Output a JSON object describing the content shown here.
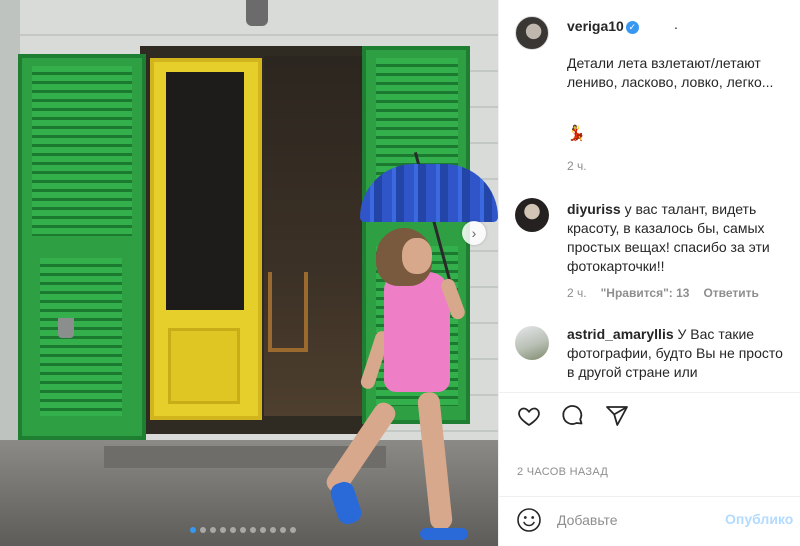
{
  "post": {
    "author": "veriga10",
    "author_suffix": ".",
    "caption": "Детали лета взлетают/летают лениво, ласково, ловко, легко...",
    "emoji": "💃",
    "time": "2 ч.",
    "posted_ago": "2 ЧАСОВ НАЗАД",
    "carousel_dots": 11,
    "active_dot": 0
  },
  "comments": [
    {
      "user": "diyuriss",
      "text": "у вас талант, видеть красоту, в казалось бы, самых простых вещах! спасибо за эти фотокарточки!!",
      "time": "2 ч.",
      "likes": "\"Нравится\": 13",
      "reply": "Ответить"
    },
    {
      "user": "astrid_amaryllis",
      "text": "У Вас такие фотографии, будто Вы не просто в другой стране или"
    }
  ],
  "comment_box": {
    "placeholder": "Добавьте",
    "publish": "Опублико"
  },
  "icons": {
    "like": "heart-icon",
    "comment": "comment-icon",
    "share": "paper-plane-icon",
    "emoji": "smile-icon",
    "verified": "verified-badge-icon",
    "next": "chevron-right-icon"
  },
  "colors": {
    "accent": "#3897f0",
    "publish_disabled": "#b3dbff",
    "secondary_text": "#8e8e8e"
  }
}
